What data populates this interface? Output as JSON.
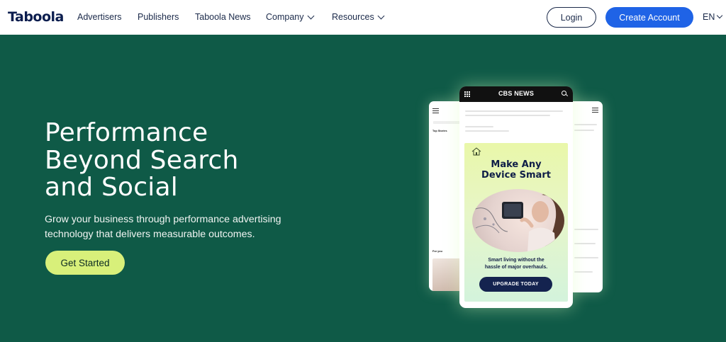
{
  "header": {
    "logo": "Taboola",
    "nav": [
      {
        "label": "Advertisers",
        "has_dropdown": false
      },
      {
        "label": "Publishers",
        "has_dropdown": false
      },
      {
        "label": "Taboola News",
        "has_dropdown": false
      },
      {
        "label": "Company",
        "has_dropdown": true
      },
      {
        "label": "Resources",
        "has_dropdown": true
      }
    ],
    "login_label": "Login",
    "create_account_label": "Create Account",
    "language": "EN"
  },
  "hero": {
    "title_lines": [
      "Performance",
      "Beyond Search",
      "and Social"
    ],
    "subtitle_lines": [
      "Grow your business through performance advertising",
      "technology that delivers measurable outcomes."
    ],
    "cta_label": "Get Started"
  },
  "mockup": {
    "main_phone": {
      "site_name": "CBS NEWS",
      "ad": {
        "headline_lines": [
          "Make Any",
          "Device Smart"
        ],
        "copy_lines": [
          "Smart living without the",
          "hassle of major overhauls."
        ],
        "cta_label": "UPGRADE TODAY"
      }
    },
    "left_phone": {
      "section_top": "Top Stories",
      "section_for_you": "For you"
    }
  },
  "colors": {
    "hero_bg": "#0f5a47",
    "primary_button": "#1f63e6",
    "cta_button": "#d8f07a",
    "logo_color": "#0b1d4e",
    "ad_cta_bg": "#14234f"
  },
  "icons": [
    "chevron-down-icon",
    "menu-grid-icon",
    "search-icon",
    "hamburger-icon",
    "house-icon"
  ]
}
